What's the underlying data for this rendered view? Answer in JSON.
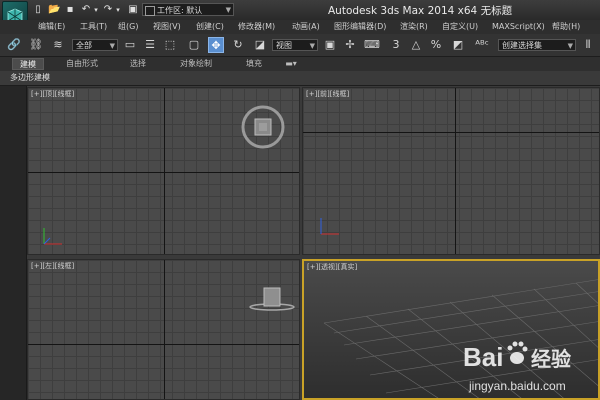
{
  "window": {
    "title": "Autodesk 3ds Max  2014 x64     无标题",
    "workspace_label": "工作区: 默认"
  },
  "menu": [
    {
      "label": "编辑(E)"
    },
    {
      "label": "工具(T)"
    },
    {
      "label": "组(G)"
    },
    {
      "label": "视图(V)"
    },
    {
      "label": "创建(C)"
    },
    {
      "label": "修改器(M)"
    },
    {
      "label": "动画(A)"
    },
    {
      "label": "图形编辑器(D)"
    },
    {
      "label": "渲染(R)"
    },
    {
      "label": "自定义(U)"
    },
    {
      "label": "MAXScript(X)"
    },
    {
      "label": "帮助(H)"
    }
  ],
  "toolbar": {
    "selection_filter": "全部",
    "ref_coord": "视图",
    "named_selection_placeholder": "创建选择集",
    "snap_label": "3",
    "angle_snap": "△",
    "percent_snap": "%"
  },
  "ribbon": {
    "tabs": [
      {
        "label": "建模"
      },
      {
        "label": "自由形式"
      },
      {
        "label": "选择"
      },
      {
        "label": "对象绘制"
      },
      {
        "label": "填充"
      }
    ],
    "panel_label": "多边形建模"
  },
  "viewports": {
    "top": {
      "label": "[+][顶][线框]"
    },
    "front": {
      "label": "[+][前][线框]"
    },
    "left": {
      "label": "[+][左][线框]"
    },
    "perspective": {
      "label": "[+][透视][真实]"
    }
  },
  "watermark": {
    "brand": "Bai",
    "brand_suffix": "经验",
    "url": "jingyan.baidu.com"
  },
  "colors": {
    "active_viewport_border": "#c9a227",
    "active_tool": "#5a8fd0",
    "logo": "#1e6d6a"
  }
}
